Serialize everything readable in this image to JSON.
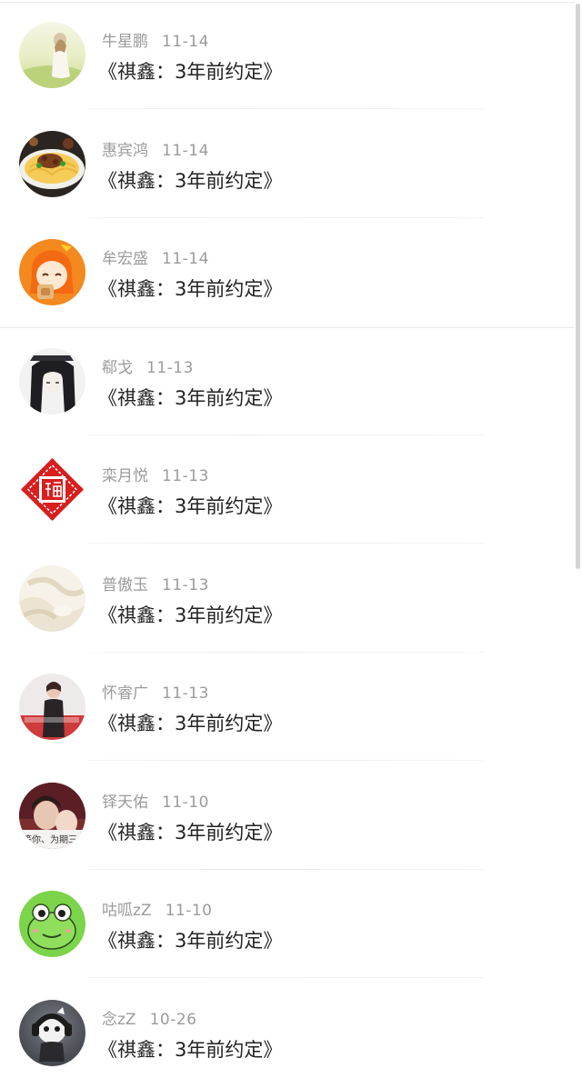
{
  "comments": [
    {
      "name": "牛星鹏",
      "date": "11-14",
      "text": "《祺鑫：3年前约定》",
      "avatar_icon": "girl-field-photo"
    },
    {
      "name": "惠宾鸿",
      "date": "11-14",
      "text": "《祺鑫：3年前约定》",
      "avatar_icon": "noodle-dish-photo"
    },
    {
      "name": "牟宏盛",
      "date": "11-14",
      "text": "《祺鑫：3年前约定》",
      "avatar_icon": "anime-orange-hair-girl"
    },
    {
      "name": "郗戈",
      "date": "11-13",
      "text": "《祺鑫：3年前约定》",
      "avatar_icon": "anime-dark-hair-girl"
    },
    {
      "name": "栾月悦",
      "date": "11-13",
      "text": "《祺鑫：3年前约定》",
      "avatar_icon": "fu-character-paper-cut"
    },
    {
      "name": "普傲玉",
      "date": "11-13",
      "text": "《祺鑫：3年前约定》",
      "avatar_icon": "cream-fabric-photo"
    },
    {
      "name": "怀睿广",
      "date": "11-13",
      "text": "《祺鑫：3年前约定》",
      "avatar_icon": "woman-portrait-photo"
    },
    {
      "name": "铎天佑",
      "date": "11-10",
      "text": "《祺鑫：3年前约定》",
      "avatar_icon": "couple-caption-photo"
    },
    {
      "name": "咕呱zZ",
      "date": "11-10",
      "text": "《祺鑫：3年前约定》",
      "avatar_icon": "green-frog-cartoon"
    },
    {
      "name": "念zZ",
      "date": "10-26",
      "text": "《祺鑫：3年前约定》",
      "avatar_icon": "headphone-figure-3d"
    }
  ],
  "avatar_captions": {
    "item_8": "等你、为期三年"
  },
  "colors": {
    "meta_text": "#9b9b9b",
    "message_text": "#222222",
    "divider": "#ededed",
    "frog_green": "#7cd44a",
    "fu_red": "#d81e1e",
    "anime_orange": "#f3891f"
  }
}
